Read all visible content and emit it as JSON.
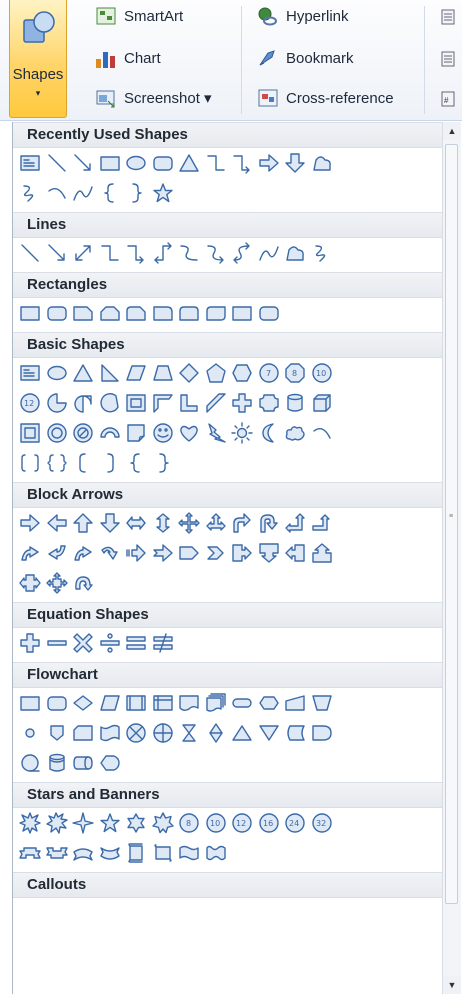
{
  "ribbon": {
    "shapes_label": "Shapes",
    "caret": "▾",
    "smartart_label": "SmartArt",
    "chart_label": "Chart",
    "screenshot_label": "Screenshot ▾",
    "hyperlink_label": "Hyperlink",
    "bookmark_label": "Bookmark",
    "crossref_label": "Cross-reference"
  },
  "sections": [
    {
      "title": "Recently Used Shapes",
      "rows": [
        [
          "textbox",
          "line",
          "arrow-line",
          "rect",
          "oval",
          "rounded-rect",
          "triangle",
          "elbow",
          "elbow-arrow",
          "right-arrow",
          "down-arrow",
          "freeform"
        ],
        [
          "scribble",
          "arc",
          "curve",
          "left-brace",
          "right-brace",
          "star5"
        ]
      ]
    },
    {
      "title": "Lines",
      "rows": [
        [
          "line",
          "arrow-line",
          "double-arrow-line",
          "elbow",
          "elbow-arrow",
          "elbow-double",
          "curved",
          "curved-arrow",
          "curved-double",
          "curve",
          "freeform",
          "scribble"
        ]
      ]
    },
    {
      "title": "Rectangles",
      "rows": [
        [
          "rect",
          "rounded-rect",
          "snip1",
          "snip2",
          "snip-round",
          "round1",
          "round2",
          "round-diag",
          "rect",
          "rounded-rect"
        ]
      ]
    },
    {
      "title": "Basic Shapes",
      "rows": [
        [
          "textbox",
          "oval",
          "triangle",
          "right-triangle",
          "parallelogram",
          "trapezoid",
          "diamond",
          "pentagon",
          "hexagon",
          "heptagon",
          "octagon",
          "decagon"
        ],
        [
          "dodecagon",
          "pie",
          "teardrop",
          "chord",
          "frame",
          "half-frame",
          "l-shape",
          "diag-stripe",
          "cross",
          "plaque",
          "can",
          "cube"
        ],
        [
          "bevel",
          "donut",
          "no-symbol",
          "block-arc",
          "folded",
          "smiley",
          "heart",
          "lightning",
          "sun",
          "moon",
          "cloud",
          "arc"
        ],
        [
          "bracket-pair",
          "brace-pair",
          "left-bracket",
          "right-bracket",
          "left-brace",
          "right-brace"
        ]
      ]
    },
    {
      "title": "Block Arrows",
      "rows": [
        [
          "right-arrow",
          "left-arrow",
          "up-arrow",
          "down-arrow",
          "left-right-arrow",
          "up-down-arrow",
          "quad-arrow",
          "left-right-up",
          "bent-arrow",
          "u-turn",
          "left-up-arrow",
          "bent-up-arrow"
        ],
        [
          "curved-right",
          "curved-left",
          "curved-up",
          "curved-down",
          "striped-right",
          "notched-right",
          "pentagon-arrow",
          "chevron",
          "right-callout",
          "down-callout",
          "left-callout",
          "up-callout"
        ],
        [
          "left-right-callout",
          "quad-callout",
          "circular-arrow"
        ]
      ]
    },
    {
      "title": "Equation Shapes",
      "rows": [
        [
          "plus",
          "minus",
          "multiply",
          "divide",
          "equal",
          "not-equal"
        ]
      ]
    },
    {
      "title": "Flowchart",
      "rows": [
        [
          "process",
          "alt-process",
          "decision",
          "data",
          "predefined",
          "internal-storage",
          "document",
          "multidoc",
          "terminator",
          "preparation",
          "manual-input",
          "manual-op"
        ],
        [
          "connector",
          "offpage",
          "card",
          "punched-tape",
          "summing",
          "or",
          "collate",
          "sort",
          "extract",
          "merge",
          "stored-data",
          "delay"
        ],
        [
          "seq-access",
          "magnetic-disk",
          "direct-access",
          "display"
        ]
      ]
    },
    {
      "title": "Stars and Banners",
      "rows": [
        [
          "explosion1",
          "explosion2",
          "star4",
          "star5",
          "star6",
          "star7",
          "star8",
          "star10",
          "star12",
          "star16",
          "star24",
          "star32"
        ],
        [
          "ribbon-up",
          "ribbon-down",
          "curved-ribbon-up",
          "curved-ribbon-down",
          "vertical-scroll",
          "horizontal-scroll",
          "wave",
          "double-wave"
        ]
      ]
    },
    {
      "title": "Callouts",
      "rows": []
    }
  ],
  "scrollbar": {
    "up": "▲",
    "down": "▼"
  }
}
